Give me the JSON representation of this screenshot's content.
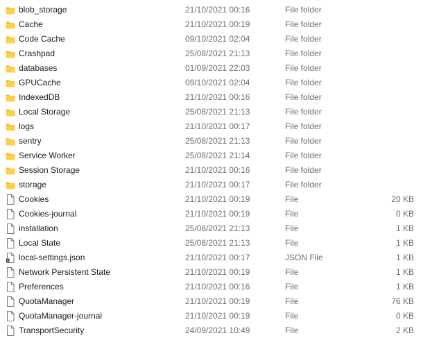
{
  "icon_legend": {
    "folder": "folder-icon",
    "file": "file-icon",
    "json": "json-file-icon"
  },
  "colors": {
    "folder_back": "#e8b43a",
    "folder_front": "#ffcf48",
    "file_outline": "#7a7a7a",
    "meta_text": "#6d6d6d"
  },
  "files": [
    {
      "icon": "folder",
      "name": "blob_storage",
      "date": "21/10/2021 00:16",
      "type": "File folder",
      "size": ""
    },
    {
      "icon": "folder",
      "name": "Cache",
      "date": "21/10/2021 00:19",
      "type": "File folder",
      "size": ""
    },
    {
      "icon": "folder",
      "name": "Code Cache",
      "date": "09/10/2021 02:04",
      "type": "File folder",
      "size": ""
    },
    {
      "icon": "folder",
      "name": "Crashpad",
      "date": "25/08/2021 21:13",
      "type": "File folder",
      "size": ""
    },
    {
      "icon": "folder",
      "name": "databases",
      "date": "01/09/2021 22:03",
      "type": "File folder",
      "size": ""
    },
    {
      "icon": "folder",
      "name": "GPUCache",
      "date": "09/10/2021 02:04",
      "type": "File folder",
      "size": ""
    },
    {
      "icon": "folder",
      "name": "IndexedDB",
      "date": "21/10/2021 00:16",
      "type": "File folder",
      "size": ""
    },
    {
      "icon": "folder",
      "name": "Local Storage",
      "date": "25/08/2021 21:13",
      "type": "File folder",
      "size": ""
    },
    {
      "icon": "folder",
      "name": "logs",
      "date": "21/10/2021 00:17",
      "type": "File folder",
      "size": ""
    },
    {
      "icon": "folder",
      "name": "sentry",
      "date": "25/08/2021 21:13",
      "type": "File folder",
      "size": ""
    },
    {
      "icon": "folder",
      "name": "Service Worker",
      "date": "25/08/2021 21:14",
      "type": "File folder",
      "size": ""
    },
    {
      "icon": "folder",
      "name": "Session Storage",
      "date": "21/10/2021 00:16",
      "type": "File folder",
      "size": ""
    },
    {
      "icon": "folder",
      "name": "storage",
      "date": "21/10/2021 00:17",
      "type": "File folder",
      "size": ""
    },
    {
      "icon": "file",
      "name": "Cookies",
      "date": "21/10/2021 00:19",
      "type": "File",
      "size": "20 KB"
    },
    {
      "icon": "file",
      "name": "Cookies-journal",
      "date": "21/10/2021 00:19",
      "type": "File",
      "size": "0 KB"
    },
    {
      "icon": "file",
      "name": "installation",
      "date": "25/08/2021 21:13",
      "type": "File",
      "size": "1 KB"
    },
    {
      "icon": "file",
      "name": "Local State",
      "date": "25/08/2021 21:13",
      "type": "File",
      "size": "1 KB"
    },
    {
      "icon": "json",
      "name": "local-settings.json",
      "date": "21/10/2021 00:17",
      "type": "JSON File",
      "size": "1 KB"
    },
    {
      "icon": "file",
      "name": "Network Persistent State",
      "date": "21/10/2021 00:19",
      "type": "File",
      "size": "1 KB"
    },
    {
      "icon": "file",
      "name": "Preferences",
      "date": "21/10/2021 00:16",
      "type": "File",
      "size": "1 KB"
    },
    {
      "icon": "file",
      "name": "QuotaManager",
      "date": "21/10/2021 00:19",
      "type": "File",
      "size": "76 KB"
    },
    {
      "icon": "file",
      "name": "QuotaManager-journal",
      "date": "21/10/2021 00:19",
      "type": "File",
      "size": "0 KB"
    },
    {
      "icon": "file",
      "name": "TransportSecurity",
      "date": "24/09/2021 10:49",
      "type": "File",
      "size": "2 KB"
    }
  ]
}
